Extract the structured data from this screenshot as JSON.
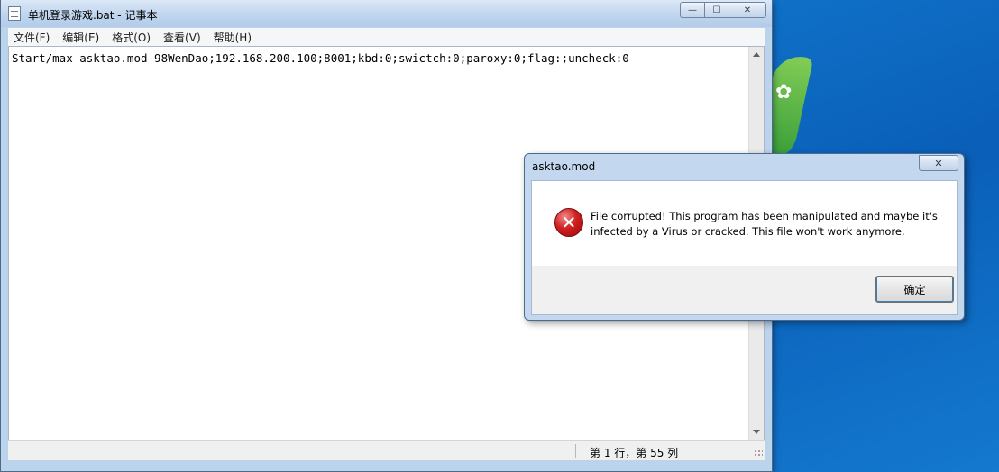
{
  "notepad": {
    "title": "单机登录游戏.bat - 记事本",
    "controls": {
      "minimize": "—",
      "maximize": "☐",
      "close": "✕"
    },
    "menu": [
      "文件(F)",
      "编辑(E)",
      "格式(O)",
      "查看(V)",
      "帮助(H)"
    ],
    "content": "Start/max asktao.mod 98WenDao;192.168.200.100;8001;kbd:0;swictch:0;paroxy:0;flag:;uncheck:0",
    "status": "第 1 行，第 55 列"
  },
  "dialog": {
    "title": "asktao.mod",
    "close": "✕",
    "icon": "error-icon",
    "message": "File corrupted! This program has been manipulated and maybe it's infected by a Virus or cracked. This file won't work anymore.",
    "ok_label": "确定"
  }
}
